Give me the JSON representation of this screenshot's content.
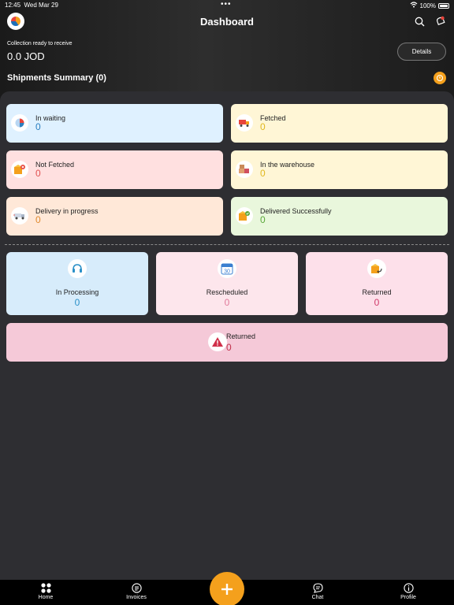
{
  "status_bar": {
    "time": "12:45",
    "date": "Wed Mar 29",
    "battery": "100%"
  },
  "header": {
    "title": "Dashboard"
  },
  "collection": {
    "label": "Collection ready to receive",
    "value": "0.0 JOD",
    "details_label": "Details"
  },
  "summary": {
    "title": "Shipments Summary (0)"
  },
  "status_cards": [
    {
      "label": "In waiting",
      "value": "0",
      "bg": "#dff1ff",
      "value_color": "#2a7fc0",
      "icon": "pie-chart-icon"
    },
    {
      "label": "Fetched",
      "value": "0",
      "bg": "#fff6d6",
      "value_color": "#e0b820",
      "icon": "delivery-truck-icon"
    },
    {
      "label": "Not Fetched",
      "value": "0",
      "bg": "#ffe0e0",
      "value_color": "#e05050",
      "icon": "box-cancel-icon"
    },
    {
      "label": "In the warehouse",
      "value": "0",
      "bg": "#fff6d6",
      "value_color": "#e0b820",
      "icon": "warehouse-boxes-icon"
    },
    {
      "label": "Delivery in progress",
      "value": "0",
      "bg": "#ffe8d8",
      "value_color": "#e08a30",
      "icon": "delivery-van-icon"
    },
    {
      "label": "Delivered Successfully",
      "value": "0",
      "bg": "#e9f7dc",
      "value_color": "#5aa83a",
      "icon": "box-check-icon"
    }
  ],
  "process_cards": [
    {
      "label": "In Processing",
      "value": "0",
      "bg": "#d7ecfb",
      "value_color": "#2a90c8",
      "icon": "headset-icon"
    },
    {
      "label": "Rescheduled",
      "value": "0",
      "bg": "#fde6ec",
      "value_color": "#e07a9a",
      "icon": "calendar-icon",
      "icon_text": "30"
    },
    {
      "label": "Returned",
      "value": "0",
      "bg": "#fde0ea",
      "value_color": "#d03a6a",
      "icon": "box-return-icon"
    }
  ],
  "returned_wide": {
    "label": "Returned",
    "value": "0",
    "bg": "#f5c9d8",
    "value_color": "#c0304a",
    "icon": "warning-icon"
  },
  "tabs": [
    {
      "label": "Home",
      "icon": "grid-icon"
    },
    {
      "label": "Invoices",
      "icon": "invoice-icon"
    },
    {
      "label": "Chat",
      "icon": "chat-icon"
    },
    {
      "label": "Profile",
      "icon": "info-icon"
    }
  ],
  "colors": {
    "accent": "#f4a01c",
    "panel": "#2e2e32"
  }
}
